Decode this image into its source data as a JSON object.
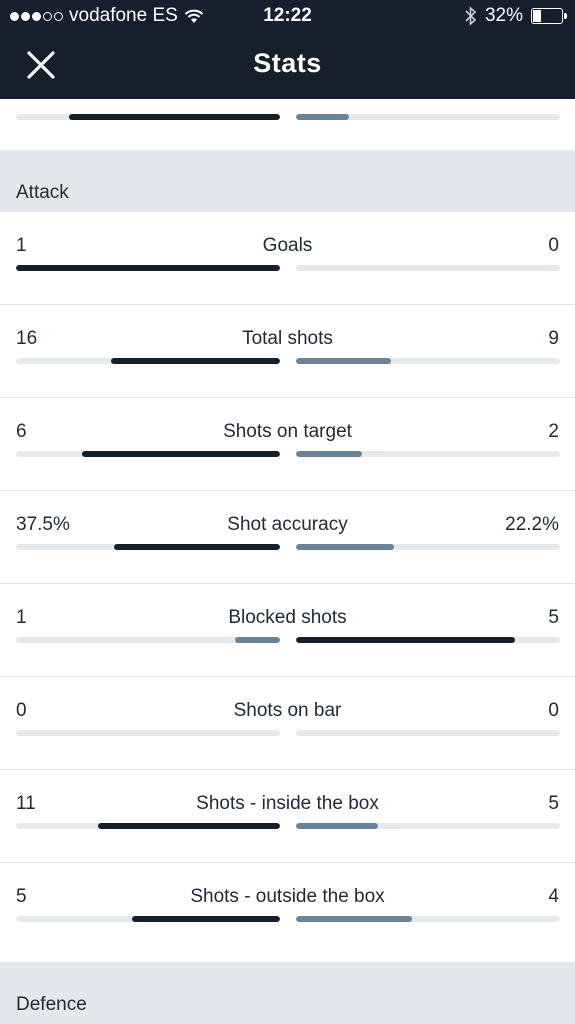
{
  "status_bar": {
    "carrier": "vodafone ES",
    "time": "12:22",
    "battery": "32%",
    "battery_level": 0.32,
    "signal_bars": 3,
    "signal_total": 5
  },
  "header": {
    "title": "Stats"
  },
  "previous_row": {
    "left_fraction": 0.8,
    "right_fraction": 0.2
  },
  "sections": {
    "attack": "Attack",
    "defence": "Defence"
  },
  "colors": {
    "home_bar": "#16202c",
    "away_bar": "#6a8396",
    "track": "#e6e9ec"
  },
  "attack_stats": [
    {
      "name": "Goals",
      "left": "1",
      "right": "0",
      "left_fraction": 1.0,
      "right_fraction": 0.0,
      "left_leads": true
    },
    {
      "name": "Total shots",
      "left": "16",
      "right": "9",
      "left_fraction": 0.64,
      "right_fraction": 0.36,
      "left_leads": true
    },
    {
      "name": "Shots on target",
      "left": "6",
      "right": "2",
      "left_fraction": 0.75,
      "right_fraction": 0.25,
      "left_leads": true
    },
    {
      "name": "Shot accuracy",
      "left": "37.5%",
      "right": "22.2%",
      "left_fraction": 0.63,
      "right_fraction": 0.37,
      "left_leads": true
    },
    {
      "name": "Blocked shots",
      "left": "1",
      "right": "5",
      "left_fraction": 0.17,
      "right_fraction": 0.83,
      "left_leads": false
    },
    {
      "name": "Shots on bar",
      "left": "0",
      "right": "0",
      "left_fraction": 0.0,
      "right_fraction": 0.0,
      "left_leads": true
    },
    {
      "name": "Shots - inside the box",
      "left": "11",
      "right": "5",
      "left_fraction": 0.69,
      "right_fraction": 0.31,
      "left_leads": true
    },
    {
      "name": "Shots - outside the box",
      "left": "5",
      "right": "4",
      "left_fraction": 0.56,
      "right_fraction": 0.44,
      "left_leads": true
    }
  ]
}
